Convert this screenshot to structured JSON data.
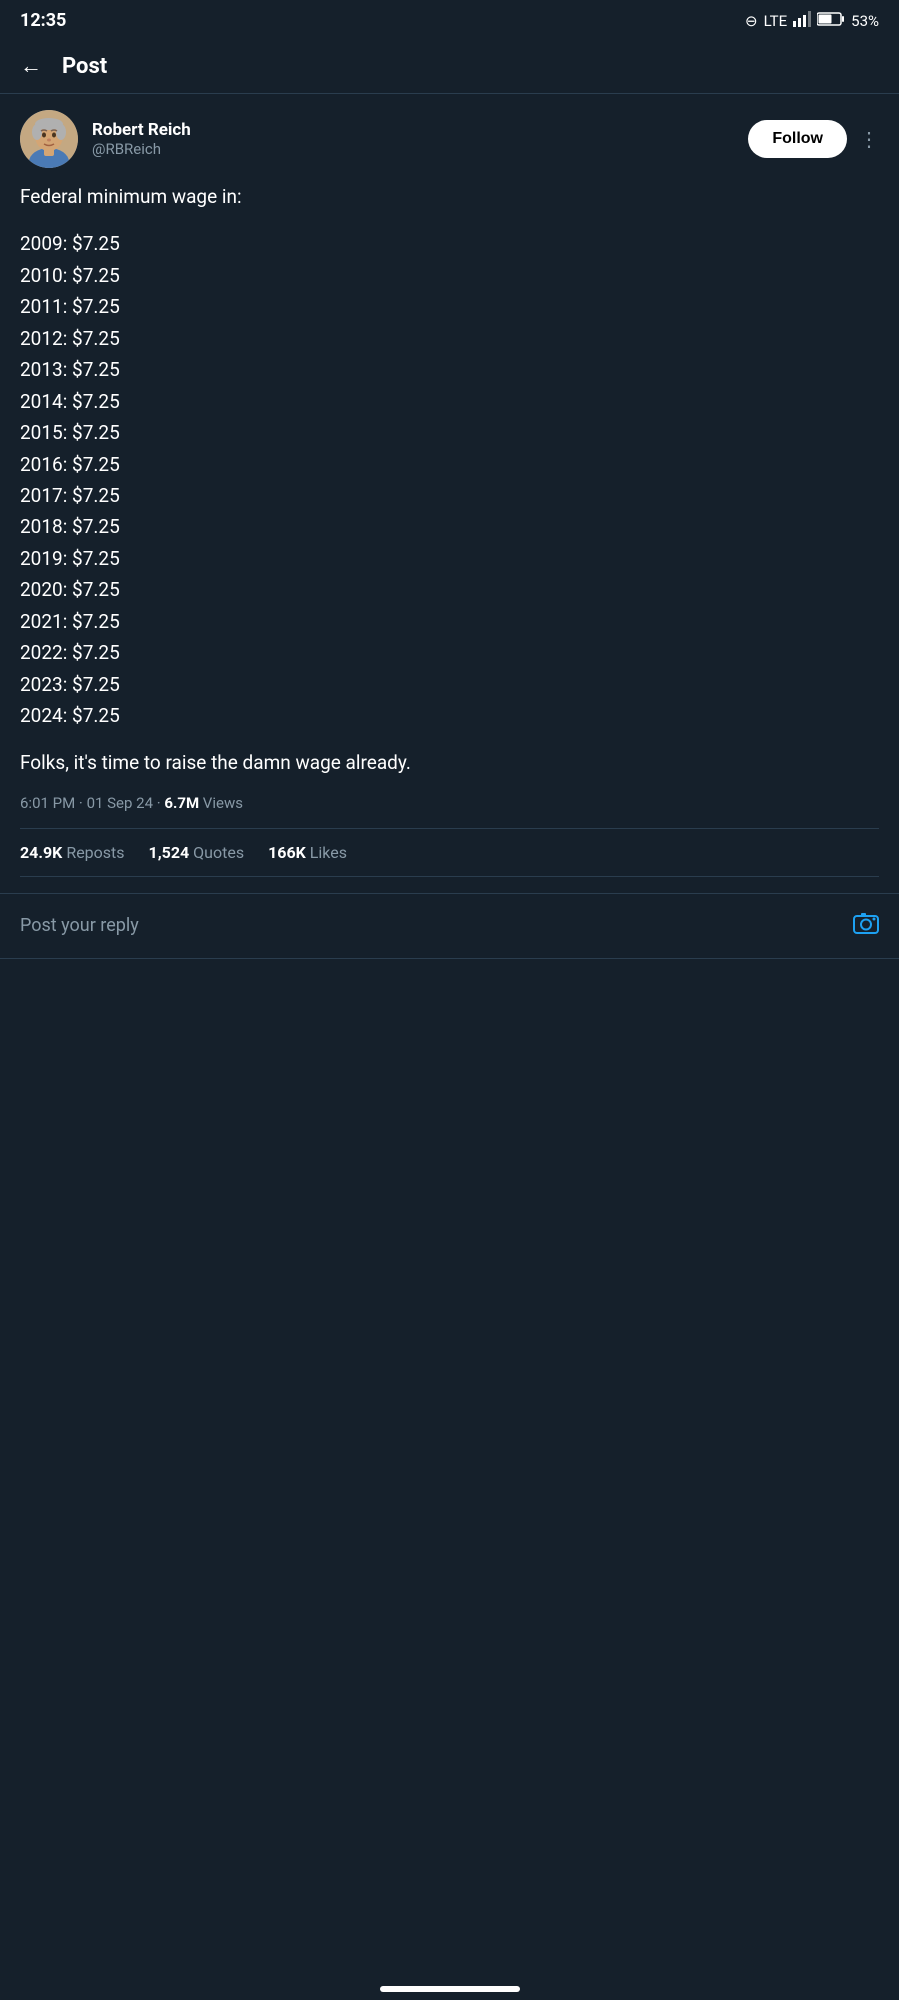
{
  "status_bar": {
    "time": "12:35",
    "signal": "LTE",
    "battery": "53%"
  },
  "header": {
    "back_label": "←",
    "title": "Post"
  },
  "user": {
    "display_name": "Robert Reich",
    "username": "@RBReich",
    "follow_label": "Follow"
  },
  "post": {
    "intro": "Federal minimum wage in:",
    "wages": [
      "2009: $7.25",
      "2010: $7.25",
      "2011: $7.25",
      "2012: $7.25",
      "2013: $7.25",
      "2014: $7.25",
      "2015: $7.25",
      "2016: $7.25",
      "2017: $7.25",
      "2018: $7.25",
      "2019: $7.25",
      "2020: $7.25",
      "2021: $7.25",
      "2022: $7.25",
      "2023: $7.25",
      "2024: $7.25"
    ],
    "conclusion": "Folks, it's time to raise the damn wage already.",
    "timestamp": "6:01 PM · 01 Sep 24 · ",
    "views_count": "6.7M",
    "views_label": " Views"
  },
  "stats": {
    "reposts_count": "24.9K",
    "reposts_label": " Reposts",
    "quotes_count": "1,524",
    "quotes_label": " Quotes",
    "likes_count": "166K",
    "likes_label": " Likes"
  },
  "reply": {
    "placeholder": "Post your reply"
  },
  "more_options_symbol": "⋮"
}
